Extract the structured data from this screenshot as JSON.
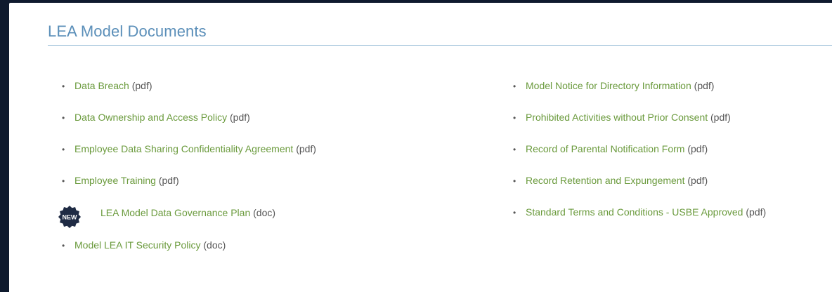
{
  "section": {
    "title": "LEA Model Documents"
  },
  "left_column": [
    {
      "label": "Data Breach",
      "type": "(pdf)"
    },
    {
      "label": "Data Ownership and Access Policy",
      "type": "(pdf)"
    },
    {
      "label": "Employee Data Sharing Confidentiality Agreement",
      "type": "(pdf)"
    },
    {
      "label": "Employee Training",
      "type": "(pdf)"
    },
    {
      "label": "LEA Model Data Governance Plan",
      "type": "(doc)",
      "badge": "NEW"
    },
    {
      "label": "Model LEA IT Security Policy",
      "type": "(doc)"
    }
  ],
  "right_column": [
    {
      "label": "Model Notice for Directory Information",
      "type": "(pdf)"
    },
    {
      "label": "Prohibited Activities without Prior Consent",
      "type": "(pdf)"
    },
    {
      "label": "Record of Parental Notification Form",
      "type": "(pdf)"
    },
    {
      "label": "Record Retention and Expungement",
      "type": "(pdf)"
    },
    {
      "label": "Standard Terms and Conditions - USBE Approved",
      "type": "(pdf)"
    }
  ],
  "colors": {
    "title": "#5b8fb9",
    "link": "#6a9a3c",
    "badge": "#1f2b44",
    "page_border": "#0f1a2e"
  },
  "icons": {
    "badge_icon": "new-badge-icon"
  }
}
